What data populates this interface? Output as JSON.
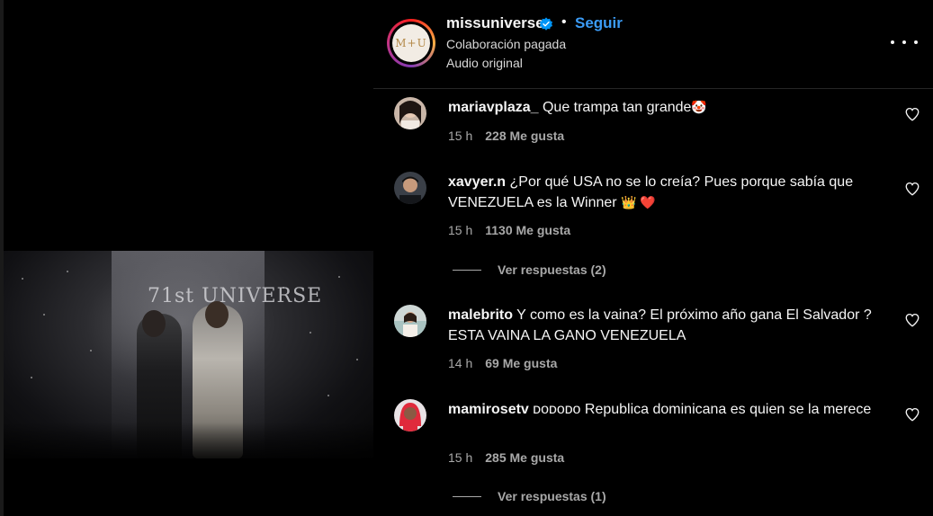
{
  "media": {
    "video_overlay_text": "71st UNIVERSE"
  },
  "post": {
    "username": "missuniverse",
    "separator": "•",
    "follow_label": "Seguir",
    "paid_partnership": "Colaboración pagada",
    "audio": "Audio original",
    "avatar_text": "M+U",
    "avatar_colors": [
      "#fd1d1d",
      "#fcaf45",
      "#833ab4",
      "#c13584"
    ],
    "follow_color": "#3b9bf5"
  },
  "comments": [
    {
      "user": "mariavplaza_",
      "text": "Que trampa tan grande",
      "emoji": "🤡",
      "time": "15 h",
      "likes": "228 Me gusta"
    },
    {
      "user": "xavyer.n",
      "text": "¿Por qué USA no se lo creía? Pues porque sabía que VENEZUELA es la Winner",
      "emoji": "👑 ❤️",
      "time": "15 h",
      "likes": "1130 Me gusta",
      "replies": "Ver respuestas (2)"
    },
    {
      "user": "malebrito",
      "text": "Y como es la vaina? El próximo año gana El Salvador ? ESTA VAINA LA GANO VENEZUELA",
      "emoji": "",
      "time": "14 h",
      "likes": "69 Me gusta"
    },
    {
      "user": "mamirosetv",
      "text": "ᴅᴏᴅᴏᴅᴏ Republica dominicana es quien se la merece",
      "emoji": "",
      "time": "15 h",
      "likes": "285 Me gusta",
      "replies": "Ver respuestas (1)"
    }
  ],
  "icons": {
    "verified": "verified-badge-icon",
    "more": "more-options-icon",
    "like": "heart-icon"
  },
  "colors": {
    "background": "#000000",
    "text_primary": "#f5f5f5",
    "text_secondary": "#a8a8a8",
    "divider": "#262626"
  }
}
